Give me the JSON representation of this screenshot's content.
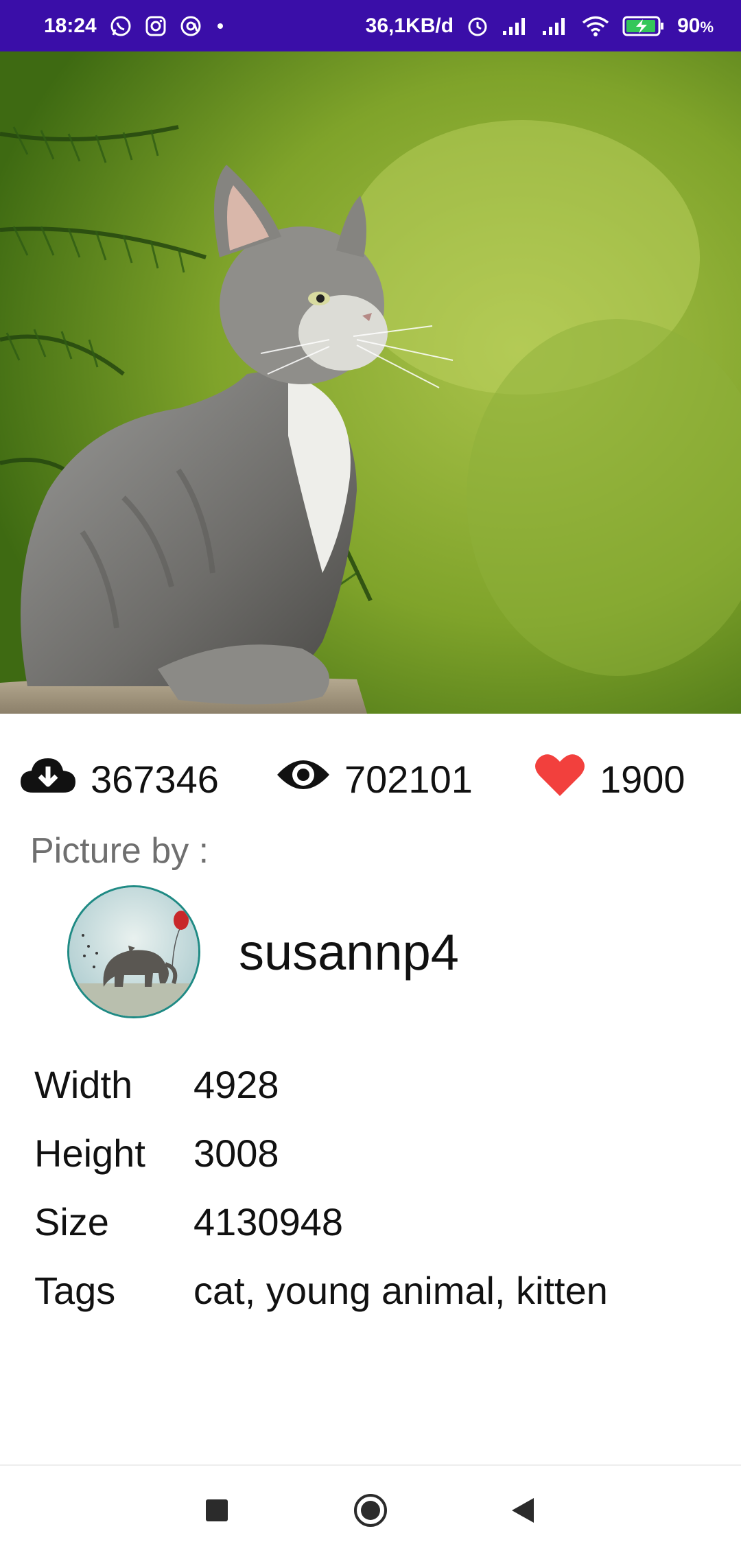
{
  "status_bar": {
    "time": "18:24",
    "speed": "36,1KB/d",
    "battery": "90",
    "battery_unit": "%",
    "left_icons": [
      "whatsapp-icon",
      "instagram-icon",
      "threads-icon",
      "dot-icon"
    ],
    "right_icons": [
      "alarm-icon",
      "signal-icon",
      "signal-icon",
      "wifi-icon",
      "battery-charging-icon"
    ]
  },
  "hero": {
    "subject": "cat"
  },
  "stats": {
    "downloads": "367346",
    "views": "702101",
    "likes": "1900",
    "download_icon": "cloud-download-icon",
    "view_icon": "eye-icon",
    "like_icon": "heart-icon",
    "like_color": "#f2403d"
  },
  "author": {
    "label": "Picture by :",
    "name": "susannp4"
  },
  "details": [
    {
      "label": "Width",
      "value": "4928"
    },
    {
      "label": "Height",
      "value": "3008"
    },
    {
      "label": "Size",
      "value": "4130948"
    },
    {
      "label": "Tags",
      "value": "cat, young animal, kitten"
    }
  ],
  "nav": {
    "recents_icon": "square-icon",
    "home_icon": "circle-icon",
    "back_icon": "triangle-back-icon"
  },
  "colors": {
    "status_bar": "#3a0ea8",
    "avatar_border": "#1f8a84"
  }
}
